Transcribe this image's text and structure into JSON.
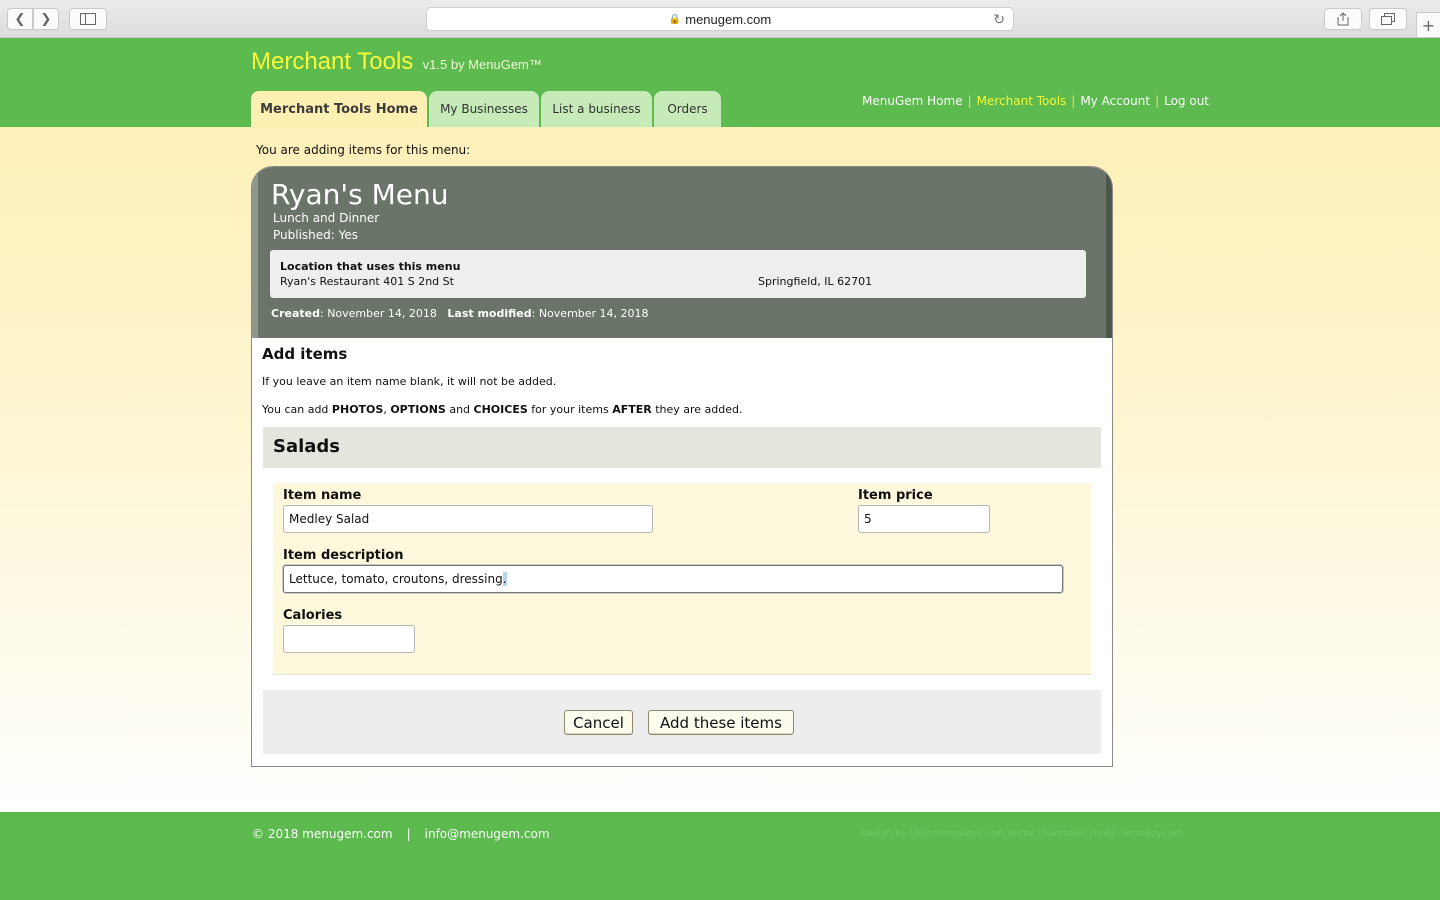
{
  "browser": {
    "url": "menugem.com",
    "back_icon": "chevron-left",
    "forward_icon": "chevron-right",
    "sidebar_icon": "sidebar",
    "share_icon": "share",
    "tabs_icon": "tabs",
    "new_tab_icon": "plus"
  },
  "header": {
    "brand_name": "Merchant Tools",
    "version": "v1.5 by MenuGem™",
    "tabs": [
      {
        "label": "Merchant Tools Home",
        "active": true
      },
      {
        "label": "My Businesses",
        "active": false
      },
      {
        "label": "List a business",
        "active": false
      },
      {
        "label": "Orders",
        "active": false
      }
    ],
    "topnav": [
      {
        "label": "MenuGem Home",
        "current": false
      },
      {
        "label": "Merchant Tools",
        "current": true
      },
      {
        "label": "My Account",
        "current": false
      },
      {
        "label": "Log out",
        "current": false
      }
    ],
    "separator": "|"
  },
  "intro_text": "You are adding items for this menu:",
  "menu": {
    "title": "Ryan's Menu",
    "subtitle": "Lunch and Dinner",
    "published_label": "Published",
    "published_value": "Yes",
    "location_title": "Location that uses this menu",
    "location_address": "Ryan's Restaurant 401 S 2nd St",
    "location_city": "Springfield, IL 62701",
    "created_label": "Created",
    "created_value": "November 14, 2018",
    "modified_label": "Last modified",
    "modified_value": "November 14, 2018"
  },
  "add_items": {
    "title": "Add items",
    "note1": "If you leave an item name blank, it will not be added.",
    "note2_parts": [
      "You can add ",
      "PHOTOS",
      ", ",
      "OPTIONS",
      " and ",
      "CHOICES",
      " for your items ",
      "AFTER",
      " they are added."
    ]
  },
  "section": {
    "name": "Salads"
  },
  "item_form": {
    "name_label": "Item name",
    "name_value": "Medley Salad",
    "price_label": "Item price",
    "price_value": "5",
    "description_label": "Item description",
    "description_value": "Lettuce, tomato, croutons, dressing",
    "description_selected": ".",
    "calories_label": "Calories",
    "calories_value": ""
  },
  "buttons": {
    "cancel": "Cancel",
    "submit": "Add these items"
  },
  "footer": {
    "copyright": "© 2018 menugem.com",
    "separator": "|",
    "email": "info@menugem.com",
    "credit": "Design by Chocotemplates.com Vector illustration credit: Vecteezy.com"
  },
  "colors": {
    "header_green": "#5cba4f",
    "brand_yellow": "#fafa3a",
    "tab_active": "#fef0b3",
    "tab_inactive": "#c6ebb8",
    "menu_header_gray": "#6a7468"
  }
}
